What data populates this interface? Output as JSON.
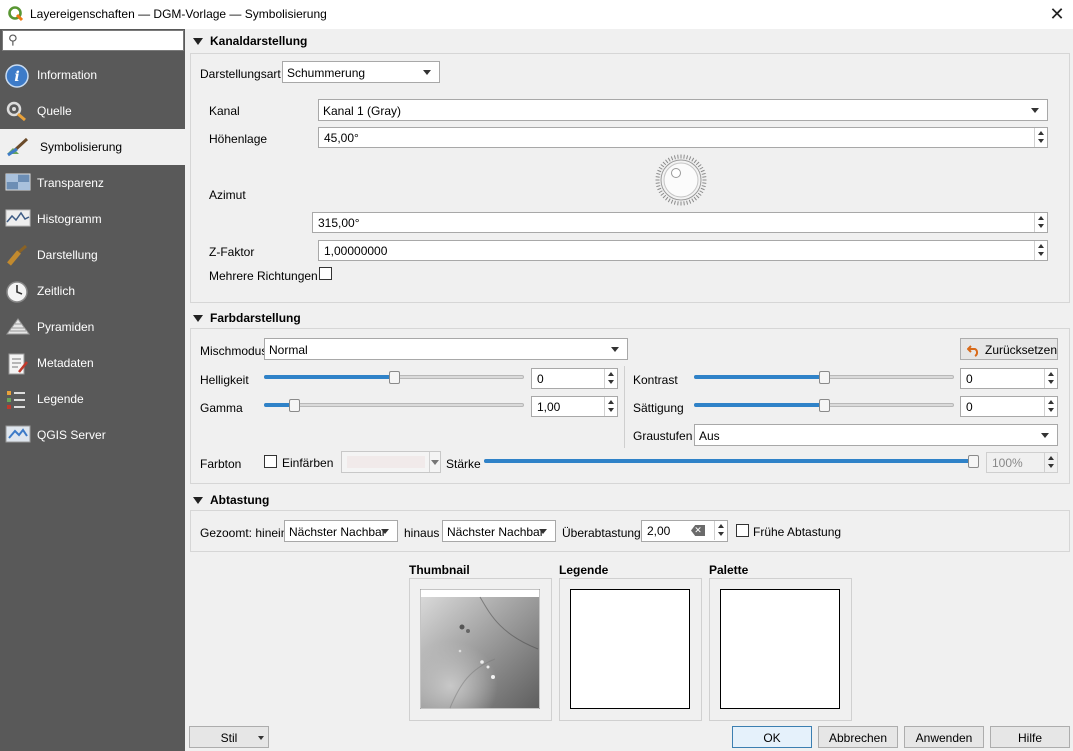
{
  "window": {
    "title": "Layereigenschaften — DGM-Vorlage — Symbolisierung"
  },
  "sidebar": {
    "items": [
      {
        "label": "Information",
        "icon": "info-icon"
      },
      {
        "label": "Quelle",
        "icon": "source-icon"
      },
      {
        "label": "Symbolisierung",
        "icon": "paintbrush-icon"
      },
      {
        "label": "Transparenz",
        "icon": "transparency-icon"
      },
      {
        "label": "Histogramm",
        "icon": "histogram-icon"
      },
      {
        "label": "Darstellung",
        "icon": "rendering-icon"
      },
      {
        "label": "Zeitlich",
        "icon": "clock-icon"
      },
      {
        "label": "Pyramiden",
        "icon": "pyramid-icon"
      },
      {
        "label": "Metadaten",
        "icon": "metadata-icon"
      },
      {
        "label": "Legende",
        "icon": "legend-icon"
      },
      {
        "label": "QGIS Server",
        "icon": "server-icon"
      }
    ],
    "active": "Symbolisierung"
  },
  "band": {
    "header": "Kanaldarstellung",
    "render_type_label": "Darstellungsart",
    "render_type": "Schummerung",
    "band_label": "Kanal",
    "band_value": "Kanal 1 (Gray)",
    "altitude_label": "Höhenlage",
    "altitude": "45,00°",
    "azimuth_label": "Azimut",
    "azimuth": "315,00°",
    "zfactor_label": "Z-Faktor",
    "zfactor": "1,00000000",
    "multidir_label": "Mehrere Richtungen"
  },
  "color": {
    "header": "Farbdarstellung",
    "blend_label": "Mischmodus",
    "blend": "Normal",
    "reset_label": "Zurücksetzen",
    "brightness_label": "Helligkeit",
    "brightness": "0",
    "brightness_level": 0.5,
    "contrast_label": "Kontrast",
    "contrast": "0",
    "contrast_level": 0.5,
    "gamma_label": "Gamma",
    "gamma": "1,00",
    "gamma_level": 0.1,
    "saturation_label": "Sättigung",
    "saturation": "0",
    "saturation_level": 0.5,
    "grayscale_label": "Graustufen",
    "grayscale": "Aus",
    "hue_label": "Farbton",
    "colorize_label": "Einfärben",
    "strength_label": "Stärke",
    "strength": "100%",
    "strength_level": 1.0
  },
  "resampling": {
    "header": "Abtastung",
    "zoomin_label": "Gezoomt: hinein",
    "zoomin": "Nächster Nachbar",
    "zoomout_label": "hinaus",
    "zoomout": "Nächster Nachbar",
    "oversampling_label": "Überabtastung",
    "oversampling": "2,00",
    "early_label": "Frühe Abtastung"
  },
  "previews": {
    "thumbnail": "Thumbnail",
    "legend": "Legende",
    "palette": "Palette"
  },
  "footer": {
    "style": "Stil",
    "ok": "OK",
    "cancel": "Abbrechen",
    "apply": "Anwenden",
    "help": "Hilfe"
  },
  "colors": {
    "accent": "#2f82c8",
    "sidebar": "#595959"
  }
}
